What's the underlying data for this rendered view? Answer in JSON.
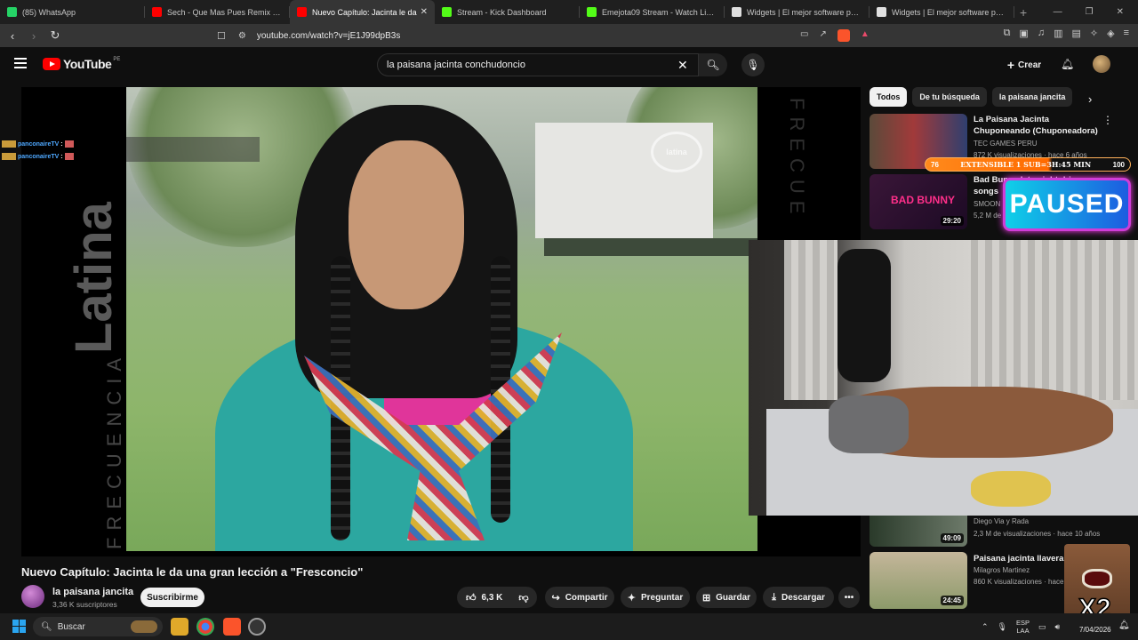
{
  "browser": {
    "tabs": [
      {
        "title": "(85) WhatsApp",
        "color": "#25d366",
        "active": false
      },
      {
        "title": "Sech - Que Mas Pues Remix ft. Maluma",
        "color": "#ff0000",
        "active": false
      },
      {
        "title": "Nuevo Capítulo: Jacinta le da",
        "color": "#ff0000",
        "active": true
      },
      {
        "title": "Stream - Kick Dashboard",
        "color": "#53fc18",
        "active": false
      },
      {
        "title": "Emejota09 Stream - Watch Live on Kick",
        "color": "#53fc18",
        "active": false
      },
      {
        "title": "Widgets | El mejor software para potenciar",
        "color": "#e0e0e0",
        "active": false
      },
      {
        "title": "Widgets | El mejor software para potenciar",
        "color": "#e0e0e0",
        "active": false
      }
    ],
    "new_tab": "+",
    "url": "youtube.com/watch?v=jE1J99dpB3s"
  },
  "youtube": {
    "logo_text": "YouTube",
    "country_code": "PE",
    "search_value": "la paisana jacinta conchudoncio",
    "create_label": "Crear",
    "video": {
      "watermark_vertical": "Latina",
      "watermark_sub": "FRECUENCIA",
      "watermark_right": "FRECUE",
      "corner_logo": "latina"
    },
    "chat_overlay": [
      {
        "user": "panconaireTV",
        "sep": ":"
      },
      {
        "user": "panconaireTV",
        "sep": ":"
      }
    ],
    "title": "Nuevo Capítulo: Jacinta le da una gran lección a \"Fresconcio\"",
    "channel": {
      "name": "la paisana jancita",
      "subscribers": "3,36 K suscriptores"
    },
    "subscribe_label": "Suscribirme",
    "actions": {
      "likes": "6,3 K",
      "share": "Compartir",
      "ask": "Preguntar",
      "save": "Guardar",
      "download": "Descargar"
    },
    "chips": [
      "Todos",
      "De tu búsqueda",
      "la paisana jancita"
    ],
    "recommendations": [
      {
        "title": "La Paisana Jacinta Chuponeando (Chuponeadora)",
        "channel": "TEC GAMES PERU",
        "meta": "872 K visualizaciones · hace 6 años",
        "duration": ""
      },
      {
        "title": "Bad Bunny late night drive songs",
        "channel": "SMOON",
        "meta": "5,2 M de visualizaciones",
        "duration": "29:20",
        "thumb_text": "BAD BUNNY"
      },
      {
        "title": "",
        "channel": "Diego Via y Rada",
        "meta": "2,3 M de visualizaciones · hace 10 años",
        "duration": "49:09"
      },
      {
        "title": "Paisana jacinta llavera",
        "channel": "Milagros Martinez",
        "meta": "860 K visualizaciones · hace",
        "duration": "24:45"
      }
    ]
  },
  "overlays": {
    "sub_goal": {
      "current": "76",
      "label": "EXTENSIBLE 1 SUB=3H:45 MIN",
      "goal": "100"
    },
    "paused_label": "PAUSED",
    "x2_label": "X2"
  },
  "taskbar": {
    "search_placeholder": "Buscar",
    "lang_line1": "ESP",
    "lang_line2": "LAA",
    "date": "7/04/2026"
  }
}
